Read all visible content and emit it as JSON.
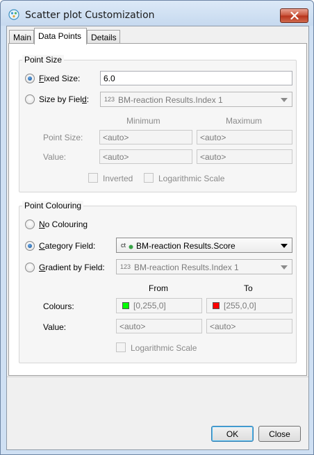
{
  "window": {
    "title": "Scatter plot Customization"
  },
  "tabs": [
    {
      "label": "Main"
    },
    {
      "label": "Data Points"
    },
    {
      "label": "Details"
    }
  ],
  "point_size": {
    "group_title": "Point Size",
    "fixed_size_label": "Fixed Size:",
    "fixed_size_underline": "F",
    "fixed_size_rest": "ixed Size:",
    "fixed_size_value": "6.0",
    "size_by_field_pre": "Size by Fiel",
    "size_by_field_ul": "d",
    "size_by_field_post": ":",
    "size_by_field_type": "123",
    "size_by_field_value": "BM-reaction Results.Index 1",
    "minimum_header": "Minimum",
    "maximum_header": "Maximum",
    "point_size_label": "Point Size:",
    "value_label": "Value:",
    "point_size_min": "<auto>",
    "point_size_max": "<auto>",
    "value_min": "<auto>",
    "value_max": "<auto>",
    "inverted_label": "Inverted",
    "log_scale_label": "Logarithmic Scale"
  },
  "point_colouring": {
    "group_title": "Point Colouring",
    "no_colouring_ul": "N",
    "no_colouring_rest": "o Colouring",
    "category_field_ul": "C",
    "category_field_rest": "ategory Field:",
    "category_field_type": "ct",
    "category_field_value": "BM-reaction Results.Score",
    "gradient_field_ul": "G",
    "gradient_field_rest": "radient by Field:",
    "gradient_field_type": "123",
    "gradient_field_value": "BM-reaction Results.Index 1",
    "from_header": "From",
    "to_header": "To",
    "colours_label": "Colours:",
    "value_label": "Value:",
    "from_colour": "[0,255,0]",
    "to_colour": "[255,0,0]",
    "from_colour_hex": "#00ff00",
    "to_colour_hex": "#ff0000",
    "value_from": "<auto>",
    "value_to": "<auto>",
    "log_scale_label": "Logarithmic Scale"
  },
  "buttons": {
    "ok": "OK",
    "close": "Close"
  }
}
